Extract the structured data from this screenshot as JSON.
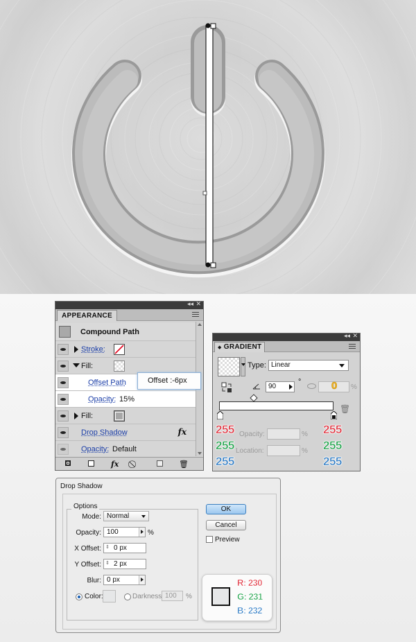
{
  "appearance": {
    "tab_label": "APPEARANCE",
    "header_title": "Compound Path",
    "stroke_label": "Stroke:",
    "fill_label": "Fill:",
    "offset_path_label": "Offset Path",
    "opacity_label": "Opacity:",
    "opacity_value": "15%",
    "fill2_label": "Fill:",
    "drop_shadow_label": "Drop Shadow",
    "opacity2_label": "Opacity:",
    "opacity2_value": "Default",
    "fx_symbol": "fx",
    "tooltip": "Offset :-6px"
  },
  "gradient": {
    "tab_label": "GRADIENT",
    "type_label": "Type:",
    "type_value": "Linear",
    "angle_value": "90",
    "degree_symbol": "°",
    "aspect_value": "0",
    "percent": "%",
    "opacity_label": "Opacity:",
    "location_label": "Location:",
    "left_stop": {
      "r": "255",
      "g": "255",
      "b": "255"
    },
    "right_stop": {
      "r": "255",
      "g": "255",
      "b": "255"
    }
  },
  "drop_shadow": {
    "title": "Drop Shadow",
    "options_label": "Options",
    "mode_label": "Mode:",
    "mode_value": "Normal",
    "opacity_label": "Opacity:",
    "opacity_value": "100",
    "percent": "%",
    "x_offset_label": "X Offset:",
    "x_offset_value": "0 px",
    "y_offset_label": "Y Offset:",
    "y_offset_value": "2 px",
    "blur_label": "Blur:",
    "blur_value": "0 px",
    "color_label": "Color:",
    "darkness_label": "Darkness:",
    "darkness_value": "100",
    "ok_label": "OK",
    "cancel_label": "Cancel",
    "preview_label": "Preview",
    "color_r": "R: 230",
    "color_g": "G: 231",
    "color_b": "B: 232"
  },
  "colors": {
    "red": "#e0303d",
    "green": "#1ea34a",
    "blue": "#2e7bc4",
    "shadow_swatch": "#e6e7e8"
  }
}
